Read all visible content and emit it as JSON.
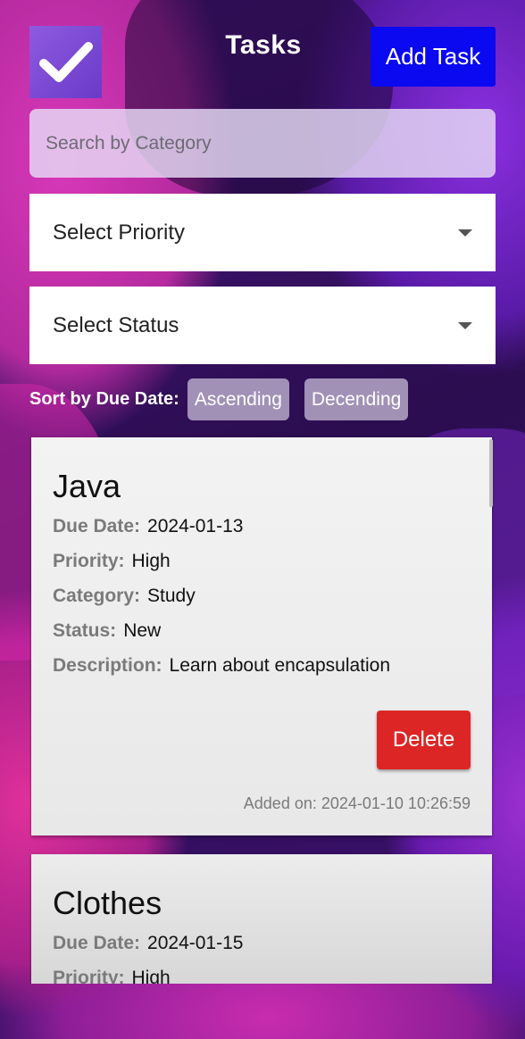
{
  "header": {
    "title": "Tasks",
    "add_task_label": "Add Task",
    "logo_icon": "checkmark-icon"
  },
  "search": {
    "placeholder": "Search by Category"
  },
  "filters": {
    "priority_label": "Select Priority",
    "status_label": "Select Status"
  },
  "sort": {
    "label": "Sort by Due Date:",
    "ascending": "Ascending",
    "descending": "Decending"
  },
  "tasks": [
    {
      "name": "Java",
      "due_date_key": "Due Date:",
      "due_date": "2024-01-13",
      "priority_key": "Priority:",
      "priority": "High",
      "category_key": "Category:",
      "category": "Study",
      "status_key": "Status:",
      "status": "New",
      "description_key": "Description:",
      "description": "Learn about encapsulation",
      "delete_label": "Delete",
      "added_on": "Added on: 2024-01-10 10:26:59"
    },
    {
      "name": "Clothes",
      "due_date_key": "Due Date:",
      "due_date": "2024-01-15",
      "priority_key": "Priority:",
      "priority": "High"
    }
  ],
  "colors": {
    "add_button": "#0a09f0",
    "delete_button": "#dc2626"
  }
}
